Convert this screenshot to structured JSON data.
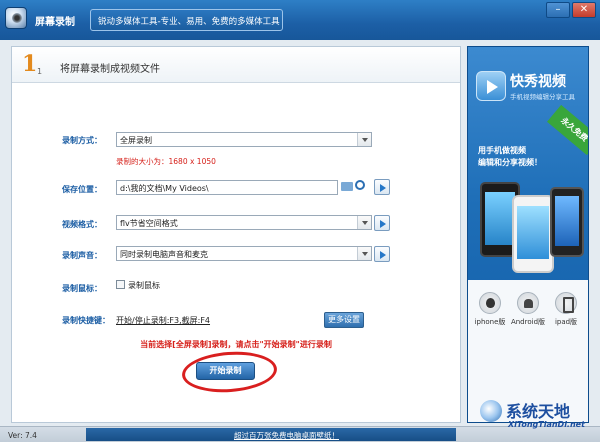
{
  "titlebar": {
    "app_title": "屏幕录制",
    "slogan": "锐动多媒体工具-专业、易用、免费的多媒体工具",
    "minimize": "–",
    "close": "✕"
  },
  "step": {
    "number": "1",
    "of": "1",
    "title": "将屏幕录制成视频文件"
  },
  "form": {
    "mode_label": "录制方式：",
    "mode_value": "全屏录制",
    "size_note": "录制的大小为：1680 x 1050",
    "save_label": "保存位置：",
    "save_value": "d:\\我的文档\\My Videos\\",
    "format_label": "视频格式：",
    "format_value": "flv节省空间格式",
    "audio_label": "录制声音：",
    "audio_value": "同时录制电脑声音和麦克",
    "mouse_label": "录制鼠标：",
    "mouse_checkbox_label": "录制鼠标",
    "hotkey_label": "录制快捷键：",
    "hotkey_value": "开始/停止录制:F3,截屏:F4",
    "more_settings": "更多设置",
    "tip": "当前选择[全屏录制]录制，请点击\"开始录制\"进行录制",
    "start_button": "开始录制"
  },
  "ad": {
    "brand": "快秀视频",
    "sub": "手机视频编辑分享工具",
    "badge": "永久免费",
    "line1": "用手机做视频",
    "line2": "编辑和分享视频！",
    "platforms": [
      "iphone版",
      "Android版",
      "ipad版"
    ]
  },
  "statusbar": {
    "version": "Ver: 7.4",
    "news": "超过百万张免费电脑桌面壁纸！"
  },
  "watermark": {
    "title": "系统天地",
    "sub": "XiTongTianDi.net"
  },
  "colors": {
    "titlebar": "#1c5fa6",
    "label_blue": "#1c5ea4",
    "warning_red": "#d6201a",
    "annotation_circle": "#d91f1f"
  }
}
